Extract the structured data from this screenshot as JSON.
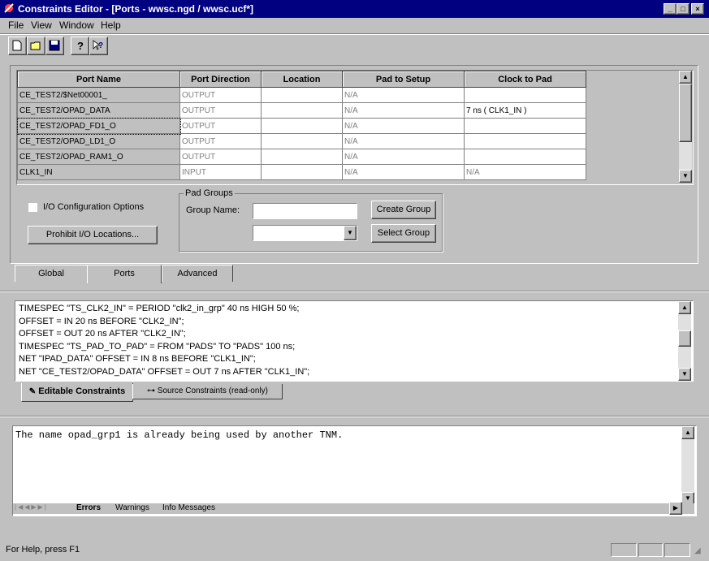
{
  "window": {
    "title": "Constraints Editor - [Ports - wwsc.ngd / wwsc.ucf*]"
  },
  "menu": {
    "items": [
      "File",
      "View",
      "Window",
      "Help"
    ]
  },
  "grid": {
    "columns": [
      "Port Name",
      "Port Direction",
      "Location",
      "Pad to Setup",
      "Clock to Pad"
    ],
    "rows": [
      [
        "CE_TEST2/$Net00001_",
        "OUTPUT",
        "",
        "N/A",
        ""
      ],
      [
        "CE_TEST2/OPAD_DATA",
        "OUTPUT",
        "",
        "N/A",
        "7 ns ( CLK1_IN )"
      ],
      [
        "CE_TEST2/OPAD_FD1_O",
        "OUTPUT",
        "",
        "N/A",
        ""
      ],
      [
        "CE_TEST2/OPAD_LD1_O",
        "OUTPUT",
        "",
        "N/A",
        ""
      ],
      [
        "CE_TEST2/OPAD_RAM1_O",
        "OUTPUT",
        "",
        "N/A",
        ""
      ],
      [
        "CLK1_IN",
        "INPUT",
        "",
        "N/A",
        "N/A"
      ]
    ]
  },
  "ports_panel": {
    "io_config_label": "I/O Configuration Options",
    "prohibit_button": "Prohibit I/O Locations...",
    "pad_groups_title": "Pad Groups",
    "group_name_label": "Group Name:",
    "group_name_value": "",
    "create_group_button": "Create Group",
    "select_group_button": "Select Group",
    "select_value": ""
  },
  "view_tabs": [
    "Global",
    "Ports",
    "Advanced"
  ],
  "constraints": {
    "lines": [
      "TIMESPEC \"TS_CLK2_IN\" = PERIOD \"clk2_in_grp\" 40 ns HIGH 50 %;",
      "OFFSET = IN 20 ns BEFORE \"CLK2_IN\";",
      "OFFSET = OUT 20 ns AFTER \"CLK2_IN\";",
      "TIMESPEC \"TS_PAD_TO_PAD\" = FROM \"PADS\" TO \"PADS\" 100 ns;",
      "NET \"IPAD_DATA\" OFFSET = IN 8 ns BEFORE \"CLK1_IN\";",
      "NET \"CE_TEST2/OPAD_DATA\" OFFSET = OUT 7 ns AFTER \"CLK1_IN\";"
    ],
    "tabs": [
      "Editable Constraints",
      "Source Constraints (read-only)"
    ]
  },
  "messages": {
    "text": "The name opad_grp1 is already being used by another TNM.",
    "tabs": [
      "Errors",
      "Warnings",
      "Info Messages"
    ]
  },
  "status": {
    "text": "For Help, press F1"
  }
}
